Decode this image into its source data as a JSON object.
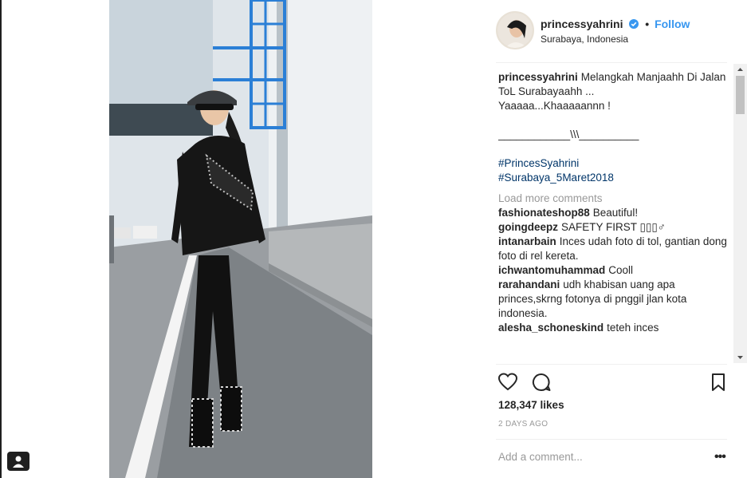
{
  "post": {
    "username": "princessyahrini",
    "follow_label": "Follow",
    "location": "Surabaya, Indonesia",
    "caption": {
      "user": "princessyahrini",
      "line1": "Melangkah Manjaahh Di Jalan ToL Surabayaahh ...",
      "line2": "Yaaaaa...Khaaaaannn !",
      "line3": "____________\\\\\\__________",
      "hashtag1": "#PrincesSyahrini",
      "hashtag2": "#Surabaya_5Maret2018"
    },
    "load_more": "Load more comments",
    "comments": [
      {
        "user": "fashionateshop88",
        "text": "Beautiful!"
      },
      {
        "user": "goingdeepz",
        "text": "SAFETY FIRST ▯▯▯♂"
      },
      {
        "user": "intanarbain",
        "text": "Inces udah foto di tol, gantian dong foto di rel kereta."
      },
      {
        "user": "ichwantomuhammad",
        "text": "Cooll"
      },
      {
        "user": "rarahandani",
        "text": "udh khabisan uang apa princes,skrng fotonya di pnggil jlan kota indonesia."
      },
      {
        "user": "alesha_schoneskind",
        "text": "teteh inces"
      }
    ],
    "likes": "128,347 likes",
    "time_ago": "2 DAYS AGO",
    "add_comment_placeholder": "Add a comment...",
    "more_options": "•••"
  },
  "icons": {
    "like": "heart-icon",
    "comment": "comment-icon",
    "save": "bookmark-icon",
    "verified": "verified-badge-icon",
    "tag": "user-tag-icon"
  },
  "colors": {
    "link_blue": "#3897f0",
    "hashtag": "#003569",
    "muted": "#999999",
    "text": "#262626"
  }
}
